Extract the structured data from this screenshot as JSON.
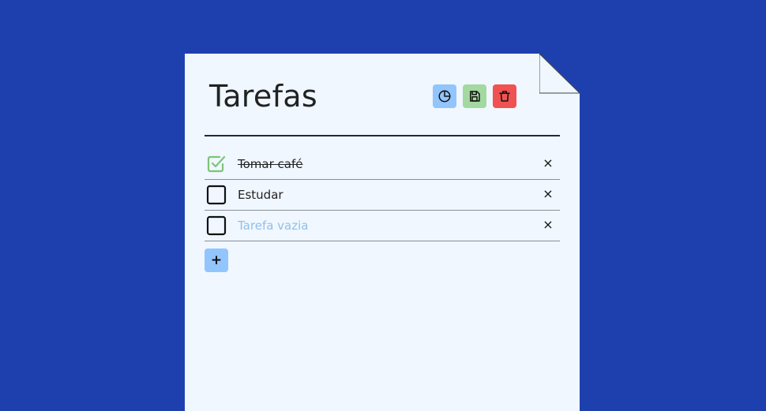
{
  "page": {
    "background": "#1e40af",
    "paper_color": "#f0f7ff"
  },
  "header": {
    "title": "Tarefas"
  },
  "toolbar": [
    {
      "name": "stats-button",
      "icon": "pie-chart-icon",
      "color": "#93c5fd"
    },
    {
      "name": "save-button",
      "icon": "floppy-disk-icon",
      "color": "#a3d9a0"
    },
    {
      "name": "delete-button",
      "icon": "trash-icon",
      "color": "#f05252"
    }
  ],
  "tasks": [
    {
      "text": "Tomar café",
      "done": true,
      "placeholder": false
    },
    {
      "text": "Estudar",
      "done": false,
      "placeholder": false
    },
    {
      "text": "Tarefa vazia",
      "done": false,
      "placeholder": true
    }
  ],
  "remove_symbol": "×",
  "add_button": {
    "label": "+"
  }
}
